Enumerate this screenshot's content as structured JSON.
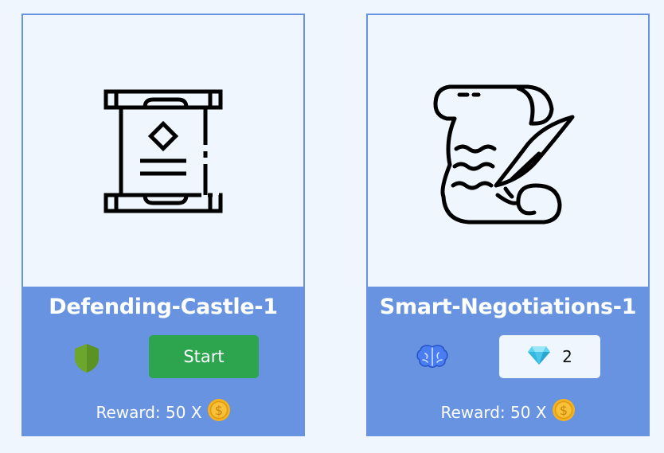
{
  "cards": [
    {
      "title": "Defending-Castle-1",
      "art_icon": "scroll-document-icon",
      "mode_icon": "shield-icon",
      "action_label": "Start",
      "reward_label": "Reward: 50 X",
      "coin_icon": "gold-coin-icon"
    },
    {
      "title": "Smart-Negotiations-1",
      "art_icon": "parchment-quill-icon",
      "mode_icon": "brain-icon",
      "price_icon": "diamond-icon",
      "price_value": "2",
      "reward_label": "Reward: 50 X",
      "coin_icon": "gold-coin-icon"
    }
  ],
  "colors": {
    "page_bg": "#eff6fd",
    "card_border": "#6793e0",
    "footer_bg": "#6793e0",
    "start_button": "#2da44e",
    "shield": "#6ca62c",
    "coin": "#f5b21d"
  }
}
